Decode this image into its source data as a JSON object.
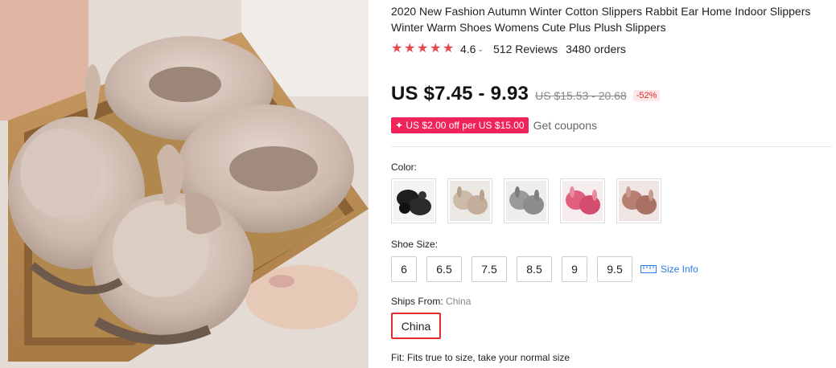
{
  "product": {
    "title": "2020 New Fashion Autumn Winter Cotton Slippers Rabbit Ear Home Indoor Slippers Winter Warm Shoes Womens Cute Plus Plush Slippers",
    "rating": "4.6",
    "rating_value": 4.6,
    "reviews": "512 Reviews",
    "orders": "3480 orders"
  },
  "pricing": {
    "price": "US $7.45 - 9.93",
    "original_price": "US $15.53 - 20.68",
    "discount": "-52%"
  },
  "coupon": {
    "badge": "✦ US $2.00 off per US $15.00",
    "link": "Get coupons",
    "badge_color": "#f0245b"
  },
  "color": {
    "label": "Color:",
    "options": [
      {
        "name": "black",
        "hex": "#1e1e1e"
      },
      {
        "name": "beige",
        "hex": "#cdbbaa"
      },
      {
        "name": "gray",
        "hex": "#9a9a9a"
      },
      {
        "name": "rose",
        "hex": "#e0607e"
      },
      {
        "name": "pink-brown",
        "hex": "#b78072"
      }
    ]
  },
  "shoe_size": {
    "label": "Shoe Size:",
    "options": [
      "6",
      "6.5",
      "7.5",
      "8.5",
      "9",
      "9.5"
    ],
    "size_info": "Size Info"
  },
  "shipping": {
    "label": "Ships From:",
    "value": "China",
    "selected": "China"
  },
  "fit": {
    "label": "Fit:",
    "text": "Fits true to size, take your normal size"
  },
  "theme": {
    "accent": "#e02c2c",
    "star": "#e7474b",
    "link": "#2c7be5"
  }
}
